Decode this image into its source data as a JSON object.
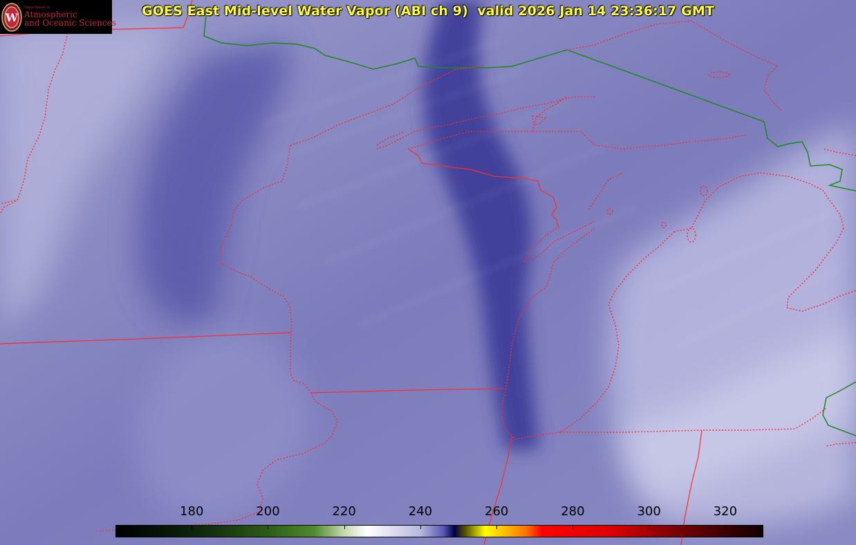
{
  "title": "GOES East Mid-level Water Vapor (ABI ch 9)  valid 2026 Jan 14 23:36:17 GMT",
  "logo": {
    "dept": "Department of",
    "line1": "Atmospheric",
    "line2": "and Oceanic Sciences",
    "seal_letter": "W"
  },
  "colorbar": {
    "min": 160,
    "max": 330,
    "ticks": [
      180,
      200,
      220,
      240,
      260,
      280,
      300,
      320
    ],
    "stops": [
      {
        "v": 160,
        "c": "#000000"
      },
      {
        "v": 180,
        "c": "#0b230b"
      },
      {
        "v": 200,
        "c": "#2c5c16"
      },
      {
        "v": 212,
        "c": "#4f8a2c"
      },
      {
        "v": 220,
        "c": "#c6d9b0"
      },
      {
        "v": 226,
        "c": "#ffffff"
      },
      {
        "v": 240,
        "c": "#b8b8df"
      },
      {
        "v": 246,
        "c": "#5858b8"
      },
      {
        "v": 249,
        "c": "#000044"
      },
      {
        "v": 252,
        "c": "#5a5a00"
      },
      {
        "v": 257,
        "c": "#ffff00"
      },
      {
        "v": 262,
        "c": "#ffc000"
      },
      {
        "v": 268,
        "c": "#ff7000"
      },
      {
        "v": 272,
        "c": "#ff0000"
      },
      {
        "v": 290,
        "c": "#dd0000"
      },
      {
        "v": 310,
        "c": "#6a0000"
      },
      {
        "v": 330,
        "c": "#100000"
      }
    ]
  },
  "colors": {
    "title": "#ffff33",
    "state_borders": "#ff2a2a",
    "country_border": "#1a8a1a",
    "background_vapor": "#7a7ab8",
    "dark_band": "#3a3a96",
    "moist_plume": "#c8c8e8"
  }
}
